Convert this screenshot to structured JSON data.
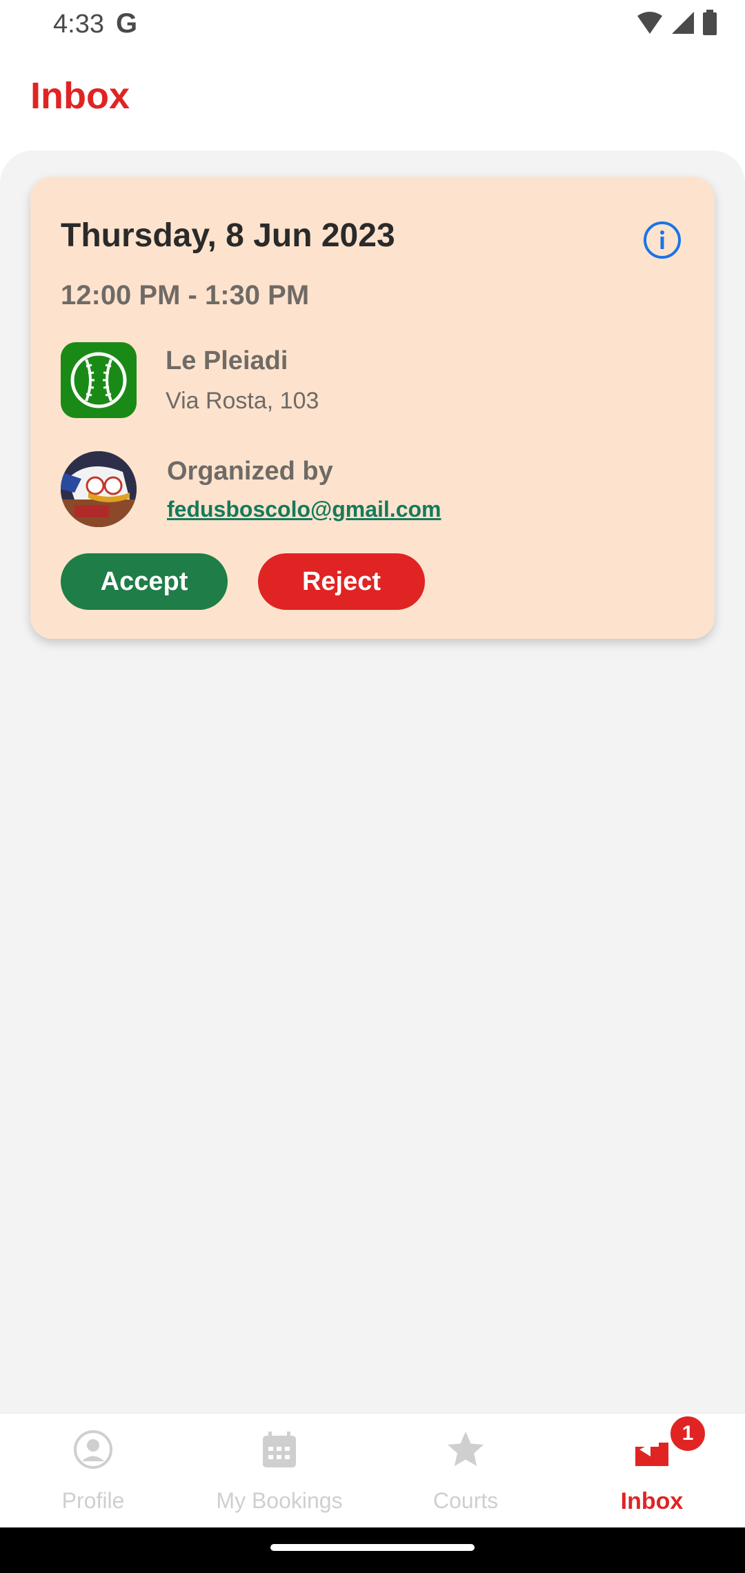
{
  "status_bar": {
    "time": "4:33"
  },
  "header": {
    "title": "Inbox"
  },
  "invitation": {
    "date": "Thursday, 8 Jun 2023",
    "time_range": "12:00 PM - 1:30 PM",
    "venue_name": "Le Pleiadi",
    "venue_address": "Via Rosta, 103",
    "organized_label": "Organized by",
    "organizer_email": "fedusboscolo@gmail.com",
    "accept_label": "Accept",
    "reject_label": "Reject"
  },
  "bottom_nav": {
    "items": [
      {
        "label": "Profile",
        "icon": "profile-icon"
      },
      {
        "label": "My Bookings",
        "icon": "calendar-icon"
      },
      {
        "label": "Courts",
        "icon": "star-icon"
      },
      {
        "label": "Inbox",
        "icon": "inbox-icon",
        "badge": "1",
        "active": true
      }
    ]
  },
  "colors": {
    "accent": "#e02424",
    "accept": "#1f7d47",
    "card_background": "#fde3cd",
    "link": "#147a5c"
  }
}
